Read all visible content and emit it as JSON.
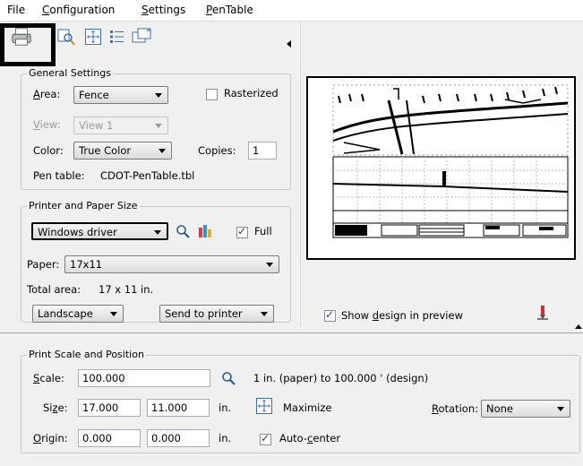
{
  "menu": {
    "file": "File",
    "configuration": "Configuration",
    "settings": "Settings",
    "pentable": "PenTable"
  },
  "toolbar": {
    "icons": [
      "printer-icon",
      "magnifier-icon",
      "maximize-icon",
      "list-icon",
      "windows-icon"
    ]
  },
  "general": {
    "title": "General Settings",
    "area_label": "Area:",
    "area_value": "Fence",
    "rasterized_label": "Rasterized",
    "rasterized": false,
    "view_label": "View:",
    "view_value": "View 1",
    "color_label": "Color:",
    "color_value": "True Color",
    "copies_label": "Copies:",
    "copies_value": "1",
    "pentable_label": "Pen table:",
    "pentable_value": "CDOT-PenTable.tbl"
  },
  "printer": {
    "title": "Printer and Paper Size",
    "driver_value": "Windows driver",
    "full_label": "Full",
    "full": true,
    "paper_label": "Paper:",
    "paper_value": "17x11",
    "total_area_label": "Total area:",
    "total_area_value": "17 x 11 in.",
    "orientation_value": "Landscape",
    "send_value": "Send to printer"
  },
  "preview": {
    "show_design_label": "Show design in preview",
    "show_design": true
  },
  "scale": {
    "title": "Print Scale and Position",
    "scale_label": "Scale:",
    "scale_value": "100.000",
    "scale_desc": "1 in. (paper) to 100.000 ' (design)",
    "size_label": "Size:",
    "size_w": "17.000",
    "size_h": "11.000",
    "size_unit": "in.",
    "maximize_label": "Maximize",
    "rotation_label": "Rotation:",
    "rotation_value": "None",
    "origin_label": "Origin:",
    "origin_x": "0.000",
    "origin_y": "0.000",
    "origin_unit": "in.",
    "autocenter_label": "Auto-center",
    "autocenter": true
  }
}
